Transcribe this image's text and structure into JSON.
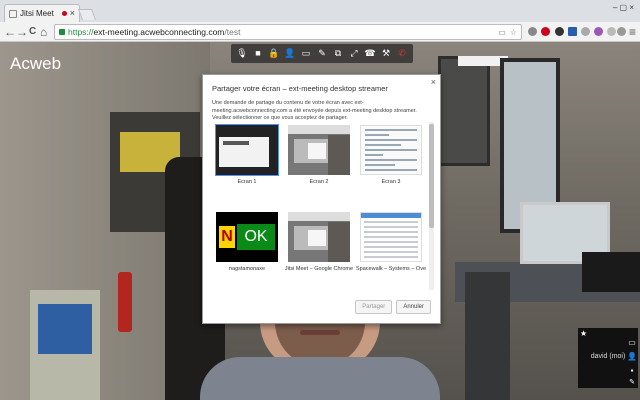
{
  "browser": {
    "tab_title": "Jitsi Meet",
    "tab_close": "×",
    "window_controls": "– ▢ ×",
    "back": "←",
    "forward": "→",
    "reload": "C",
    "home": "⌂",
    "url_scheme": "https://",
    "url_host": "ext-meeting.acwebconnecting.com",
    "url_path": "/test",
    "menu": "≡"
  },
  "meeting": {
    "room_name": "Acweb",
    "toolbar": [
      {
        "name": "microphone-icon",
        "glyph": "🎙"
      },
      {
        "name": "camera-icon",
        "glyph": "■"
      },
      {
        "name": "lock-icon",
        "glyph": "🔒"
      },
      {
        "name": "invite-icon",
        "glyph": "👤"
      },
      {
        "name": "chat-icon",
        "glyph": "▭"
      },
      {
        "name": "etherpad-icon",
        "glyph": "✎"
      },
      {
        "name": "desktop-share-icon",
        "glyph": "⧉"
      },
      {
        "name": "fullscreen-icon",
        "glyph": "⤢"
      },
      {
        "name": "sip-call-icon",
        "glyph": "☎"
      },
      {
        "name": "settings-icon",
        "glyph": "⚒"
      },
      {
        "name": "hangup-icon",
        "glyph": "✆"
      }
    ],
    "local_name": "david (moi)"
  },
  "dialog": {
    "title": "Partager votre écran – ext-meeting desktop streamer",
    "description": "Une demande de partage du contenu de votre écran avec ext-meeting.acwebconnecting.com a été envoyée depuis ext-meeting desktop streamer. Veuillez sélectionner ce que vous acceptez de partager.",
    "sources": [
      {
        "label": "Écran 1",
        "preview": "dark"
      },
      {
        "label": "Écran 2",
        "preview": "shot"
      },
      {
        "label": "Écran 3",
        "preview": "code"
      },
      {
        "label": "nagstamonaxe",
        "preview": "ok"
      },
      {
        "label": "Jitsi Meet – Google Chrome",
        "preview": "shot"
      },
      {
        "label": "Spacewalk – Systems – Over...",
        "preview": "sheet"
      }
    ],
    "preview_ok_letter": "N",
    "preview_ok_text": "OK",
    "share_button": "Partager",
    "cancel_button": "Annuler",
    "close": "×"
  },
  "colors": {
    "hangup": "#e0322b",
    "secure_url": "#1e8e3e",
    "selection": "#4d90fe"
  }
}
